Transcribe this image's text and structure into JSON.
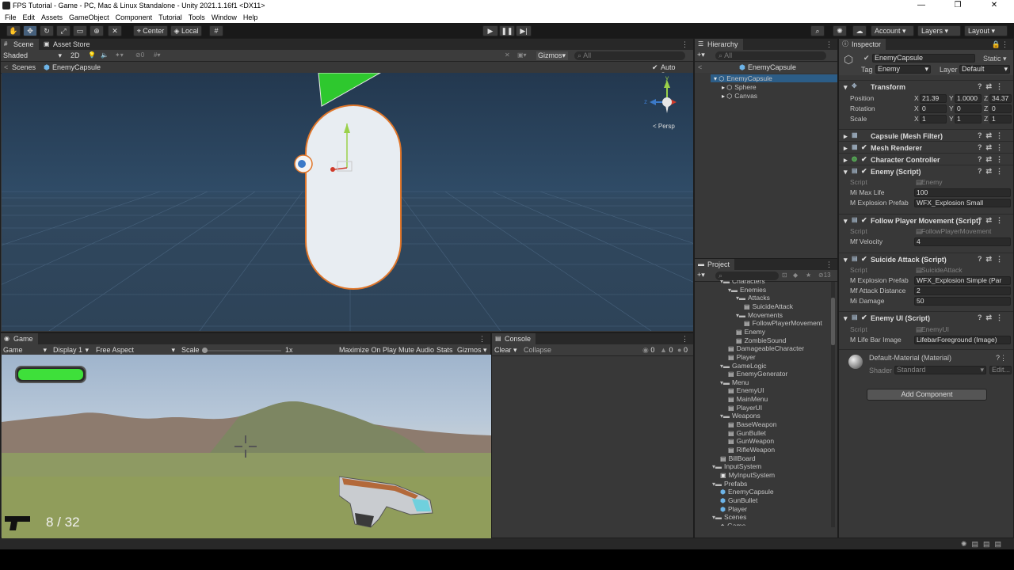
{
  "window": {
    "title": "FPS Tutorial - Game - PC, Mac & Linux Standalone - Unity 2021.1.16f1 <DX11>",
    "minimize": "—",
    "maximize": "❐",
    "close": "✕"
  },
  "menu": [
    "File",
    "Edit",
    "Assets",
    "GameObject",
    "Component",
    "Tutorial",
    "Tools",
    "Window",
    "Help"
  ],
  "toolbar": {
    "pivot": "Center",
    "space": "Local",
    "account": "Account",
    "layers": "Layers",
    "layout": "Layout"
  },
  "scene": {
    "tabs": [
      "Scene",
      "Asset Store"
    ],
    "shading": "Shaded",
    "mode_2d": "2D",
    "hidden_count": "0",
    "gizmos": "Gizmos",
    "search_placeholder": "All",
    "breadcrumb_root": "Scenes",
    "breadcrumb_obj": "EnemyCapsule",
    "auto_save": "Auto Save",
    "persp": "< Persp",
    "axis_y": "y",
    "axis_z": "z"
  },
  "game": {
    "tab": "Game",
    "mode": "Game",
    "display": "Display 1",
    "aspect": "Free Aspect",
    "scale_label": "Scale",
    "scale_value": "1x",
    "scale_fraction": 0.0,
    "buttons": [
      "Maximize On Play",
      "Mute Audio",
      "Stats",
      "Gizmos"
    ],
    "ammo": "8 / 32",
    "health_fraction": 1.0
  },
  "console": {
    "tab": "Console",
    "clear": "Clear",
    "collapse": "Collapse",
    "counts": [
      "0",
      "0",
      "0"
    ]
  },
  "hierarchy": {
    "tab": "Hierarchy",
    "search_placeholder": "All",
    "header": "EnemyCapsule",
    "items": [
      {
        "label": "EnemyCapsule",
        "level": 0,
        "icon": "cube"
      },
      {
        "label": "Sphere",
        "level": 1,
        "icon": "cube"
      },
      {
        "label": "Canvas",
        "level": 1,
        "icon": "cube"
      }
    ]
  },
  "project": {
    "tab": "Project",
    "count": "13",
    "items": [
      {
        "label": "Characters",
        "level": 1,
        "icon": "folder"
      },
      {
        "label": "Enemies",
        "level": 2,
        "icon": "folder"
      },
      {
        "label": "Attacks",
        "level": 3,
        "icon": "folder"
      },
      {
        "label": "SuicideAttack",
        "level": 4,
        "icon": "script"
      },
      {
        "label": "Movements",
        "level": 3,
        "icon": "folder"
      },
      {
        "label": "FollowPlayerMovement",
        "level": 4,
        "icon": "script"
      },
      {
        "label": "Enemy",
        "level": 3,
        "icon": "script"
      },
      {
        "label": "ZombieSound",
        "level": 3,
        "icon": "script"
      },
      {
        "label": "DamageableCharacter",
        "level": 2,
        "icon": "script"
      },
      {
        "label": "Player",
        "level": 2,
        "icon": "script"
      },
      {
        "label": "GameLogic",
        "level": 1,
        "icon": "folder"
      },
      {
        "label": "EnemyGenerator",
        "level": 2,
        "icon": "script"
      },
      {
        "label": "Menu",
        "level": 1,
        "icon": "folder"
      },
      {
        "label": "EnemyUI",
        "level": 2,
        "icon": "script"
      },
      {
        "label": "MainMenu",
        "level": 2,
        "icon": "script"
      },
      {
        "label": "PlayerUI",
        "level": 2,
        "icon": "script"
      },
      {
        "label": "Weapons",
        "level": 1,
        "icon": "folder"
      },
      {
        "label": "BaseWeapon",
        "level": 2,
        "icon": "script"
      },
      {
        "label": "GunBullet",
        "level": 2,
        "icon": "script"
      },
      {
        "label": "GunWeapon",
        "level": 2,
        "icon": "script"
      },
      {
        "label": "RifleWeapon",
        "level": 2,
        "icon": "script"
      },
      {
        "label": "BillBoard",
        "level": 1,
        "icon": "script"
      },
      {
        "label": "InputSystem",
        "level": 0,
        "icon": "folder"
      },
      {
        "label": "MyInputSystem",
        "level": 1,
        "icon": "asset"
      },
      {
        "label": "Prefabs",
        "level": 0,
        "icon": "folder"
      },
      {
        "label": "EnemyCapsule",
        "level": 1,
        "icon": "prefab"
      },
      {
        "label": "GunBullet",
        "level": 1,
        "icon": "prefab"
      },
      {
        "label": "Player",
        "level": 1,
        "icon": "prefab"
      },
      {
        "label": "Scenes",
        "level": 0,
        "icon": "folder"
      },
      {
        "label": "Game",
        "level": 1,
        "icon": "scene"
      }
    ]
  },
  "inspector": {
    "tab": "Inspector",
    "object_name": "EnemyCapsule",
    "static": "Static",
    "tag_label": "Tag",
    "tag": "Enemy",
    "layer_label": "Layer",
    "layer": "Default",
    "transform": {
      "title": "Transform",
      "position_label": "Position",
      "rotation_label": "Rotation",
      "scale_label": "Scale",
      "position": [
        "21.39",
        "1.0000",
        "34.37"
      ],
      "rotation": [
        "0",
        "0",
        "0"
      ],
      "scale": [
        "1",
        "1",
        "1"
      ],
      "axes": [
        "X",
        "Y",
        "Z"
      ]
    },
    "components": [
      "Capsule (Mesh Filter)",
      "Mesh Renderer",
      "Character Controller"
    ],
    "enemy": {
      "title": "Enemy (Script)",
      "script_label": "Script",
      "script": "Enemy",
      "f1_label": "Mi Max Life",
      "f1": "100",
      "f2_label": "M Explosion Prefab",
      "f2": "WFX_Explosion Small"
    },
    "follow": {
      "title": "Follow Player Movement (Script)",
      "script_label": "Script",
      "script": "FollowPlayerMovement",
      "f1_label": "Mf Velocity",
      "f1": "4"
    },
    "suicide": {
      "title": "Suicide Attack (Script)",
      "script_label": "Script",
      "script": "SuicideAttack",
      "f1_label": "M Explosion Prefab",
      "f1": "WFX_Explosion Simple (Par",
      "f2_label": "Mf Attack Distance",
      "f2": "2",
      "f3_label": "Mi Damage",
      "f3": "50"
    },
    "enemyui": {
      "title": "Enemy UI (Script)",
      "script_label": "Script",
      "script": "EnemyUI",
      "f1_label": "M Life Bar Image",
      "f1": "LifebarForeground (Image)"
    },
    "material": {
      "title": "Default-Material (Material)",
      "shader_label": "Shader",
      "shader": "Standard",
      "edit": "Edit..."
    },
    "add_component": "Add Component"
  }
}
